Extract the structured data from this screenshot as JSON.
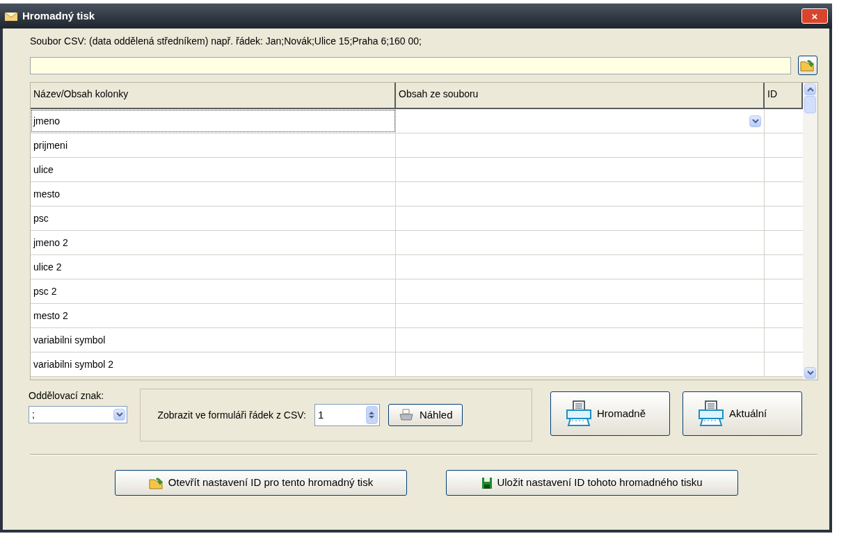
{
  "window": {
    "title": "Hromadný tisk",
    "close": "×"
  },
  "csv_file": {
    "label": "Soubor CSV: (data oddělená středníkem)  např. řádek: Jan;Novák;Ulice 15;Praha 6;160 00;"
  },
  "table": {
    "columns": [
      "Název/Obsah kolonky",
      "Obsah ze souboru",
      "ID"
    ],
    "rows": [
      {
        "name": "jmeno",
        "selected": true
      },
      {
        "name": "prijmeni",
        "selected": false
      },
      {
        "name": "ulice",
        "selected": false
      },
      {
        "name": "mesto",
        "selected": false
      },
      {
        "name": "psc",
        "selected": false
      },
      {
        "name": "jmeno 2",
        "selected": false
      },
      {
        "name": "ulice 2",
        "selected": false
      },
      {
        "name": "psc 2",
        "selected": false
      },
      {
        "name": "mesto 2",
        "selected": false
      },
      {
        "name": "variabilni symbol",
        "selected": false
      },
      {
        "name": "variabilni symbol 2",
        "selected": false
      }
    ]
  },
  "separator": {
    "label": "Oddělovací znak:",
    "value": ";"
  },
  "preview_group": {
    "label": "Zobrazit ve formuláři řádek z CSV:",
    "row_value": "1",
    "preview_button": "Náhled"
  },
  "print_buttons": [
    "Hromadně",
    "Aktuální"
  ],
  "bottom_buttons": [
    {
      "kind": "open",
      "label": "Otevřít nastavení ID pro tento hromadný tisk"
    },
    {
      "kind": "save",
      "label": "Uložit nastavení ID tohoto hromadného tisku"
    }
  ]
}
